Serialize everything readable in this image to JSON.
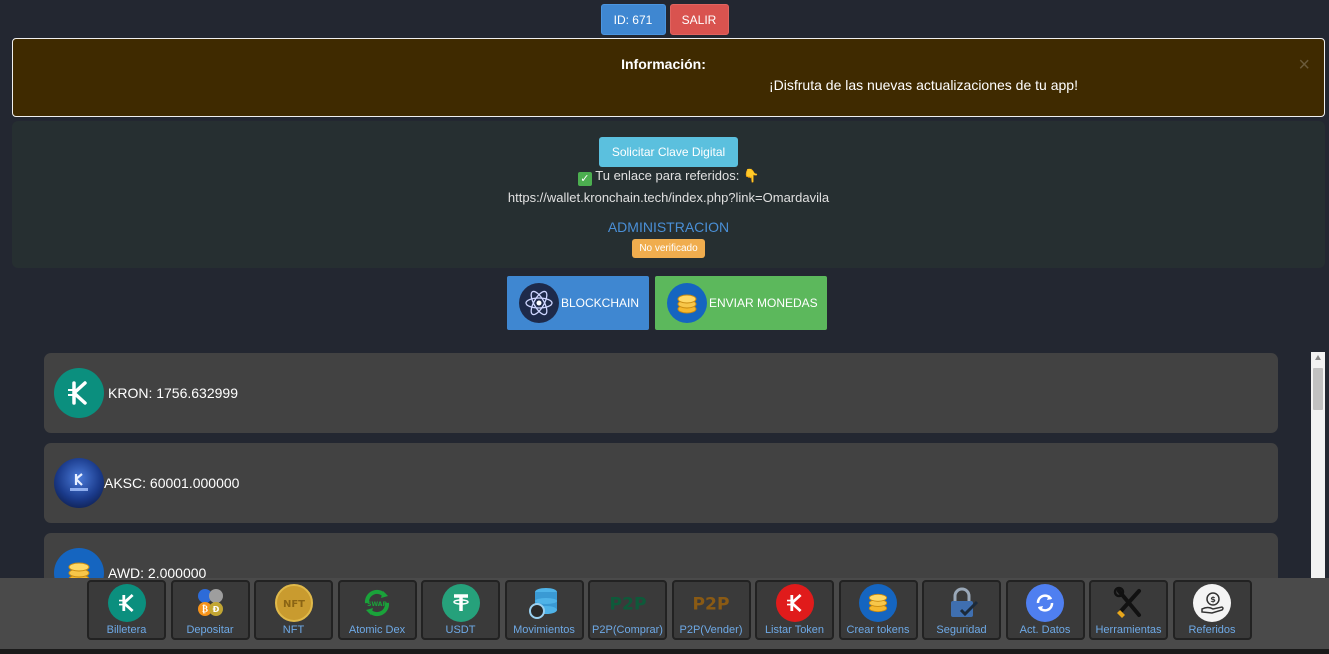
{
  "topbar": {
    "id_label": "ID: 671",
    "logout_label": "SALIR"
  },
  "alert": {
    "title": "Información:",
    "message": "¡Disfruta de las nuevas actualizaciones de tu app!",
    "close": "×"
  },
  "panel": {
    "digital_key_button": "Solicitar Clave Digital",
    "referral_label": "Tu enlace para referidos:",
    "referral_link": "https://wallet.kronchain.tech/index.php?link=Omardavila",
    "admin_label": "ADMINISTRACION",
    "status_badge": "No verificado"
  },
  "actions": {
    "blockchain_label": "BLOCKCHAIN",
    "send_label": "ENVIAR MONEDAS"
  },
  "coins": [
    {
      "symbol": "KRON",
      "balance": "1756.632999",
      "text": "KRON: 1756.632999",
      "icon": "kron-logo-icon",
      "color": "#0b8f7e"
    },
    {
      "symbol": "AKSC",
      "balance": "60001.000000",
      "text": "AKSC: 60001.000000",
      "icon": "aksc-logo-icon",
      "color": "#1a3a8a"
    },
    {
      "symbol": "AWD",
      "balance": "2.000000",
      "text": "AWD: 2.000000",
      "icon": "coins-icon",
      "color": "#1565c0"
    }
  ],
  "nav": [
    {
      "label": "Billetera",
      "icon": "kron-logo-icon"
    },
    {
      "label": "Depositar",
      "icon": "crypto-coins-icon"
    },
    {
      "label": "NFT",
      "icon": "nft-coin-icon"
    },
    {
      "label": "Atomic Dex",
      "icon": "swap-icon"
    },
    {
      "label": "USDT",
      "icon": "tether-icon"
    },
    {
      "label": "Movimientos",
      "icon": "database-sync-icon"
    },
    {
      "label": "P2P(Comprar)",
      "icon": "p2p-buy-icon"
    },
    {
      "label": "P2P(Vender)",
      "icon": "p2p-sell-icon"
    },
    {
      "label": "Listar Token",
      "icon": "kron-red-icon"
    },
    {
      "label": "Crear tokens",
      "icon": "coins-icon"
    },
    {
      "label": "Seguridad",
      "icon": "padlock-icon"
    },
    {
      "label": "Act. Datos",
      "icon": "refresh-icon"
    },
    {
      "label": "Herramientas",
      "icon": "tools-icon"
    },
    {
      "label": "Referidos",
      "icon": "money-hand-icon"
    }
  ],
  "colors": {
    "primary": "#3f87d1",
    "danger": "#d9534f",
    "success": "#5cb85c",
    "info": "#5bc0de",
    "warning": "#f0ad4e",
    "background": "#232731"
  }
}
